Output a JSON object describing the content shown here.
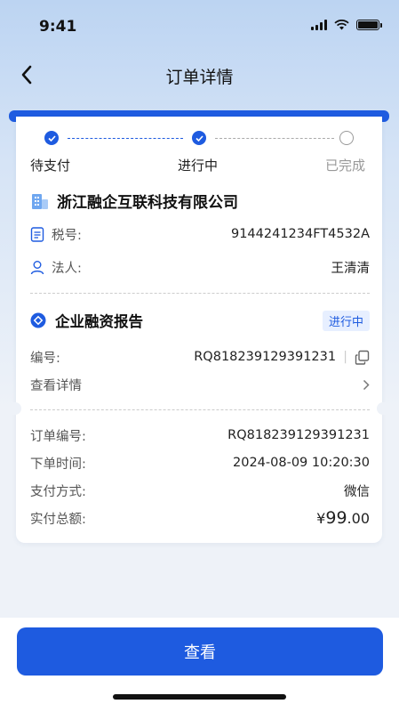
{
  "status_bar": {
    "time": "9:41"
  },
  "nav": {
    "title": "订单详情"
  },
  "steps": [
    {
      "label": "待支付",
      "state": "done"
    },
    {
      "label": "进行中",
      "state": "done"
    },
    {
      "label": "已完成",
      "state": "pending"
    }
  ],
  "company": {
    "name": "浙江融企互联科技有限公司",
    "tax_label": "税号:",
    "tax_value": "9144241234FT4532A",
    "legal_label": "法人:",
    "legal_value": "王清清"
  },
  "report": {
    "title": "企业融资报告",
    "status_badge": "进行中",
    "number_label": "编号:",
    "number_value": "RQ818239129391231",
    "view_detail": "查看详情"
  },
  "order": {
    "number_label": "订单编号:",
    "number_value": "RQ818239129391231",
    "time_label": "下单时间:",
    "time_value": "2024-08-09 10:20:30",
    "pay_method_label": "支付方式:",
    "pay_method_value": "微信",
    "amount_label": "实付总额:",
    "amount_currency": "¥",
    "amount_int": "99",
    "amount_dec": ".00"
  },
  "footer": {
    "view_button": "查看"
  },
  "colors": {
    "accent": "#1e5be0",
    "price": "#e0202c",
    "badge_bg": "#e7efff"
  }
}
